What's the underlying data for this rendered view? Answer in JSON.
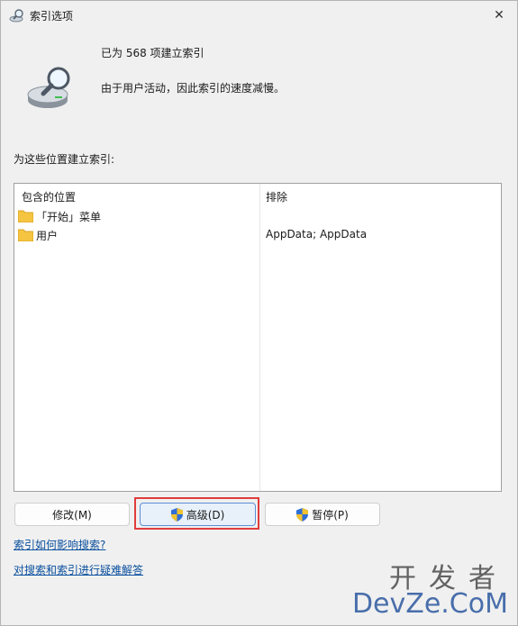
{
  "window": {
    "title": "索引选项",
    "close_glyph": "✕"
  },
  "status": {
    "count_text": "已为 568 项建立索引",
    "message": "由于用户活动，因此索引的速度减慢。"
  },
  "locations": {
    "section_label": "为这些位置建立索引:",
    "col_included": "包含的位置",
    "col_excluded": "排除",
    "rows": [
      {
        "location": "「开始」菜单",
        "excluded": ""
      },
      {
        "location": "用户",
        "excluded": "AppData; AppData"
      }
    ]
  },
  "buttons": {
    "modify": "修改(M)",
    "advanced": "高级(D)",
    "pause": "暂停(P)"
  },
  "links": {
    "how_affects": "索引如何影响搜索?",
    "troubleshoot": "对搜索和索引进行疑难解答"
  },
  "watermark": {
    "cn": "开发者",
    "en": "DevZe.CoM"
  },
  "colors": {
    "link": "#0a4f9e",
    "highlight": "#e03c3c",
    "folder": "#f5c542"
  }
}
